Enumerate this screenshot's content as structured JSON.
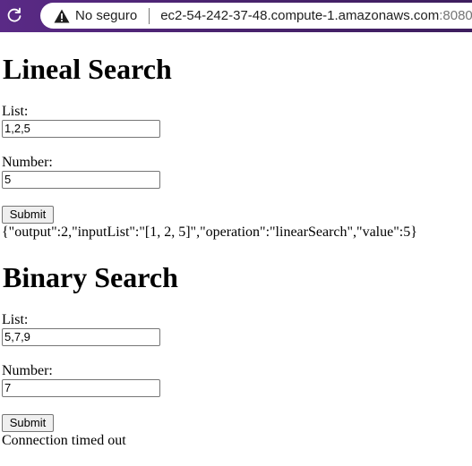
{
  "browser": {
    "security_label": "No seguro",
    "url_host": "ec2-54-242-37-48.compute-1.amazonaws.com",
    "url_port": ":8080",
    "icons": {
      "reload": "reload-icon",
      "warning": "warning-icon"
    }
  },
  "linear": {
    "heading": "Lineal Search",
    "list_label": "List:",
    "list_value": "1,2,5",
    "number_label": "Number:",
    "number_value": "5",
    "submit_label": "Submit",
    "result": "{\"output\":2,\"inputList\":\"[1, 2, 5]\",\"operation\":\"linearSearch\",\"value\":5}"
  },
  "binary": {
    "heading": "Binary Search",
    "list_label": "List:",
    "list_value": "5,7,9",
    "number_label": "Number:",
    "number_value": "7",
    "submit_label": "Submit",
    "result": "Connection timed out"
  }
}
